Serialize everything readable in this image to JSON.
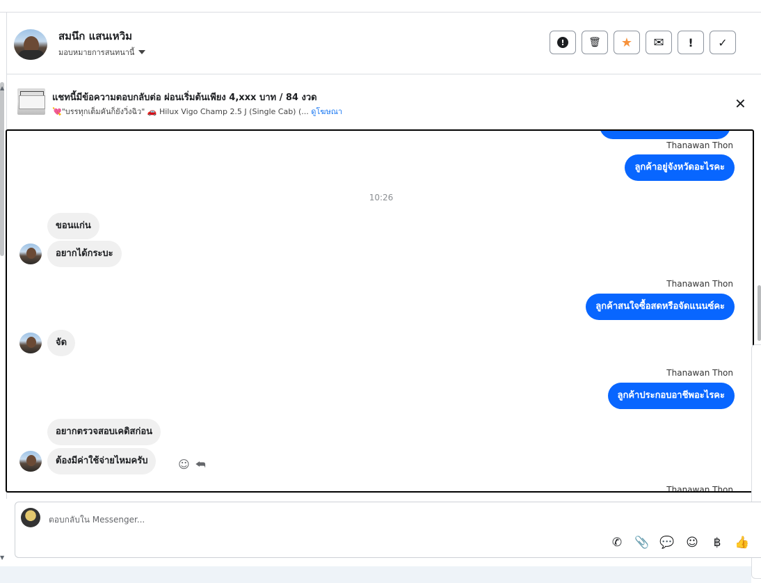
{
  "header": {
    "name": "สมนึก แสนเหวิม",
    "assign_label": "มอบหมายการสนทนานี้",
    "actions": [
      {
        "icon": "alert-circle-icon",
        "glyph": "!"
      },
      {
        "icon": "trash-icon",
        "glyph": "🗑"
      },
      {
        "icon": "star-icon",
        "glyph": "★"
      },
      {
        "icon": "envelope-icon",
        "glyph": "✉"
      },
      {
        "icon": "exclamation-icon",
        "glyph": "!"
      },
      {
        "icon": "check-icon",
        "glyph": "✓"
      }
    ]
  },
  "ad": {
    "title": "แชทนี้มีข้อความตอบกลับต่อ ผ่อนเริ่มต้นเพียง 4,xxx บาท / 84 งวด",
    "subtitle": "💘\"บรรทุกเต็มคันก็ยังวิ่งฉิว\" 🚗 Hilux Vigo Champ 2.5 J (Single Cab) (...",
    "link": "ดูโฆษณา",
    "close_glyph": "✕"
  },
  "conversation": {
    "timestamp": "10:26",
    "messages": [
      {
        "side": "out",
        "sender": "Thanawan Thon",
        "text": "ลูกค้าอยู่จังหวัดอะไรคะ"
      },
      {
        "side": "in",
        "text": "ขอนแก่น"
      },
      {
        "side": "in",
        "text": "อยากได้กระบะ"
      },
      {
        "side": "out",
        "sender": "Thanawan Thon",
        "text": "ลูกค้าสนใจซื้อสดหรือจัดแนนซ์คะ"
      },
      {
        "side": "in",
        "text": "จัด"
      },
      {
        "side": "out",
        "sender": "Thanawan Thon",
        "text": "ลูกค้าประกอบอาชีพอะไรคะ"
      },
      {
        "side": "in",
        "text": "อยากตรวจสอบเคดิสก่อน"
      },
      {
        "side": "in",
        "text": "ต้องมีค่าใช้จ่ายไหมครับ"
      },
      {
        "side": "out",
        "sender": "Thanawan Thon",
        "text": ""
      }
    ],
    "hover_icons": {
      "emoji": "☺",
      "reply": "⮪"
    }
  },
  "composer": {
    "placeholder": "ตอบกลับใน Messenger...",
    "tools": [
      {
        "icon": "phone-plus-icon",
        "glyph": "✆"
      },
      {
        "icon": "paperclip-icon",
        "glyph": "📎"
      },
      {
        "icon": "saved-reply-icon",
        "glyph": "💬"
      },
      {
        "icon": "emoji-icon",
        "glyph": "☺"
      },
      {
        "icon": "baht-icon",
        "glyph": "฿"
      },
      {
        "icon": "thumbs-up-icon",
        "glyph": "👍"
      }
    ]
  },
  "colors": {
    "accent": "#0866ff",
    "incoming_bubble": "#f0f0f0",
    "star": "#f7923b"
  }
}
